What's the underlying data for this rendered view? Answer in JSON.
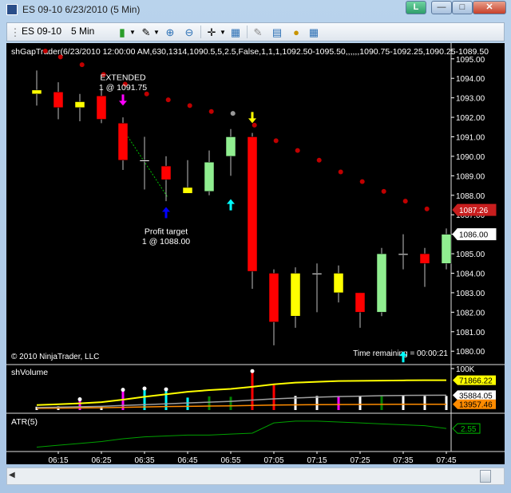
{
  "window": {
    "title": "ES 09-10  6/23/2010 (5 Min)",
    "button_l": "L"
  },
  "toolbar": {
    "instrument": "ES 09-10",
    "interval": "5 Min"
  },
  "chart_data": {
    "type": "candlestick",
    "indicator_label": "shGapTrader(6/23/2010 12:00:00 AM,630,1314,1090.5,5,2.5,False,1,1,1,1092.50-1095.50,,,,,,1090.75-1092.25,1090.25-1089.50",
    "copyright": "© 2010 NinjaTrader, LLC",
    "time_remaining": "Time remaining = 00:00:21",
    "price_ylim": [
      1079.6,
      1095.4
    ],
    "price_ticks": [
      1080,
      1081,
      1082,
      1083,
      1084,
      1085,
      1086,
      1087,
      1088,
      1089,
      1090,
      1091,
      1092,
      1093,
      1094,
      1095
    ],
    "price_tick_labels": [
      "1080.00",
      "1081.00",
      "1082.00",
      "1083.00",
      "1084.00",
      "1085.00",
      "1086.00",
      "1087.00",
      "1088.00",
      "1089.00",
      "1090.00",
      "1091.00",
      "1092.00",
      "1093.00",
      "1094.00",
      "1095.00"
    ],
    "price_badges": [
      {
        "value": 1087.25,
        "label": "1087.26",
        "color": "#c81e1e"
      },
      {
        "value": 1086.0,
        "label": "1086.00",
        "color": "#ffffff"
      }
    ],
    "x_labels": [
      "06:15",
      "06:25",
      "06:35",
      "06:45",
      "06:55",
      "07:05",
      "07:15",
      "07:25",
      "07:35",
      "07:45"
    ],
    "x_label_index": [
      1,
      3,
      5,
      7,
      9,
      11,
      13,
      15,
      17,
      19
    ],
    "candles": [
      {
        "o": 1093.4,
        "h": 1094.4,
        "l": 1092.6,
        "c": 1093.2,
        "color": "#ffff00"
      },
      {
        "o": 1093.3,
        "h": 1093.8,
        "l": 1091.9,
        "c": 1092.5,
        "color": "#ff0000"
      },
      {
        "o": 1092.5,
        "h": 1093.2,
        "l": 1091.8,
        "c": 1092.8,
        "color": "#ffff00"
      },
      {
        "o": 1093.1,
        "h": 1093.5,
        "l": 1091.7,
        "c": 1091.9,
        "color": "#ff0000"
      },
      {
        "o": 1091.7,
        "h": 1092.0,
        "l": 1089.3,
        "c": 1089.8,
        "color": "#ff0000"
      },
      {
        "o": 1089.8,
        "h": 1091.0,
        "l": 1088.3,
        "c": 1089.8,
        "color": "#ffffff"
      },
      {
        "o": 1089.5,
        "h": 1090.0,
        "l": 1087.7,
        "c": 1088.8,
        "color": "#ff0000"
      },
      {
        "o": 1088.4,
        "h": 1089.8,
        "l": 1088.1,
        "c": 1088.1,
        "color": "#ffff00"
      },
      {
        "o": 1088.2,
        "h": 1090.3,
        "l": 1088.0,
        "c": 1089.7,
        "color": "#90ee90"
      },
      {
        "o": 1090.0,
        "h": 1091.4,
        "l": 1089.0,
        "c": 1091.0,
        "color": "#90ee90"
      },
      {
        "o": 1091.0,
        "h": 1091.2,
        "l": 1083.2,
        "c": 1084.1,
        "color": "#ff0000"
      },
      {
        "o": 1084.0,
        "h": 1084.2,
        "l": 1080.3,
        "c": 1081.5,
        "color": "#ff0000"
      },
      {
        "o": 1081.8,
        "h": 1084.3,
        "l": 1081.2,
        "c": 1084.0,
        "color": "#ffff00"
      },
      {
        "o": 1084.0,
        "h": 1084.5,
        "l": 1082.0,
        "c": 1084.0,
        "color": "#ffffff"
      },
      {
        "o": 1084.0,
        "h": 1084.4,
        "l": 1082.5,
        "c": 1083.0,
        "color": "#ffff00"
      },
      {
        "o": 1083.0,
        "h": 1083.0,
        "l": 1081.2,
        "c": 1082.0,
        "color": "#ff0000"
      },
      {
        "o": 1082.0,
        "h": 1085.3,
        "l": 1081.8,
        "c": 1085.0,
        "color": "#90ee90"
      },
      {
        "o": 1085.0,
        "h": 1086.0,
        "l": 1084.2,
        "c": 1085.0,
        "color": "#ffffff"
      },
      {
        "o": 1085.0,
        "h": 1085.3,
        "l": 1083.3,
        "c": 1084.5,
        "color": "#ff0000"
      },
      {
        "o": 1084.5,
        "h": 1086.3,
        "l": 1084.2,
        "c": 1086.0,
        "color": "#90ee90"
      }
    ],
    "stop_dots": [
      {
        "i": 0.4,
        "v": 1095.4
      },
      {
        "i": 1.1,
        "v": 1095.1
      },
      {
        "i": 2.1,
        "v": 1094.7
      },
      {
        "i": 3.1,
        "v": 1094.2
      },
      {
        "i": 4.1,
        "v": 1093.7
      },
      {
        "i": 5.1,
        "v": 1093.2
      },
      {
        "i": 6.1,
        "v": 1092.9
      },
      {
        "i": 7.1,
        "v": 1092.6
      },
      {
        "i": 8.1,
        "v": 1092.3
      },
      {
        "i": 9.1,
        "v": 1092.2,
        "gray": true
      },
      {
        "i": 10.1,
        "v": 1091.6
      },
      {
        "i": 11.1,
        "v": 1090.8
      },
      {
        "i": 12.1,
        "v": 1090.3
      },
      {
        "i": 13.1,
        "v": 1089.8
      },
      {
        "i": 14.1,
        "v": 1089.2
      },
      {
        "i": 15.1,
        "v": 1088.7
      },
      {
        "i": 16.1,
        "v": 1088.2
      },
      {
        "i": 17.1,
        "v": 1087.7
      },
      {
        "i": 18.1,
        "v": 1087.3
      }
    ],
    "annotations": [
      {
        "text": "EXTENDED",
        "i": 4.0,
        "v": 1093.9
      },
      {
        "text": "1 @ 1091.75",
        "i": 4.0,
        "v": 1093.4
      },
      {
        "text": "Profit target",
        "i": 6.0,
        "v": 1086.0
      },
      {
        "text": "1 @ 1088.00",
        "i": 6.0,
        "v": 1085.5
      }
    ],
    "arrows": [
      {
        "i": 4,
        "v": 1092.6,
        "dir": "down",
        "color": "#ff00ff"
      },
      {
        "i": 6,
        "v": 1087.4,
        "dir": "up",
        "color": "#0000ff"
      },
      {
        "i": 9,
        "v": 1087.8,
        "dir": "up",
        "color": "#00ffff"
      },
      {
        "i": 10,
        "v": 1091.7,
        "dir": "down",
        "color": "#ffff00"
      },
      {
        "i": 17,
        "v": 1080.0,
        "dir": "up",
        "color": "#00ffff"
      }
    ],
    "volume": {
      "label": "shVolume",
      "ylim": [
        0,
        100000
      ],
      "ticks": [
        100000
      ],
      "tick_labels": [
        "100K"
      ],
      "badges": [
        {
          "value": 71866.22,
          "label": "71866.22",
          "color": "#ffff00"
        },
        {
          "value": 35884.05,
          "label": "35884.05",
          "color": "#ffffff"
        },
        {
          "value": 13957.46,
          "label": "13957.46",
          "color": "#ff8c00"
        }
      ],
      "bars": [
        {
          "v": 8000,
          "color": "#ffffff"
        },
        {
          "v": 9000,
          "color": "#ffffff"
        },
        {
          "v": 22000,
          "color": "#ff00ff"
        },
        {
          "v": 9000,
          "color": "#ffffff"
        },
        {
          "v": 45000,
          "color": "#ff00ff"
        },
        {
          "v": 48000,
          "color": "#00ffff"
        },
        {
          "v": 46000,
          "color": "#00ffff"
        },
        {
          "v": 30000,
          "color": "#00ffff"
        },
        {
          "v": 33000,
          "color": "#008000"
        },
        {
          "v": 32000,
          "color": "#008000"
        },
        {
          "v": 90000,
          "color": "#ff0000"
        },
        {
          "v": 60000,
          "color": "#ff0000"
        },
        {
          "v": 34000,
          "color": "#ffffff"
        },
        {
          "v": 34000,
          "color": "#ffffff"
        },
        {
          "v": 34000,
          "color": "#ff00ff"
        },
        {
          "v": 34000,
          "color": "#ffffff"
        },
        {
          "v": 34000,
          "color": "#008000"
        },
        {
          "v": 34000,
          "color": "#ffffff"
        },
        {
          "v": 34000,
          "color": "#ffffff"
        },
        {
          "v": 34000,
          "color": "#ffffff"
        }
      ],
      "dots": [
        2,
        4,
        5,
        6,
        10
      ],
      "avg_yellow": [
        12000,
        14000,
        16000,
        19000,
        25000,
        32000,
        38000,
        44000,
        48000,
        51000,
        56000,
        62000,
        66000,
        68000,
        70000,
        70500,
        71000,
        71500,
        71800,
        71866.22
      ],
      "avg_white": [
        6000,
        7000,
        8000,
        9000,
        11000,
        13000,
        15000,
        17000,
        19000,
        21000,
        24000,
        27000,
        29000,
        31000,
        32500,
        33500,
        34500,
        35200,
        35600,
        35884.05
      ],
      "avg_orange": [
        4000,
        4500,
        5000,
        5500,
        6500,
        7500,
        8500,
        9000,
        9500,
        10000,
        11000,
        12000,
        12500,
        13000,
        13300,
        13500,
        13700,
        13850,
        13900,
        13957.46
      ]
    },
    "atr": {
      "label": "ATR(5)",
      "ylim": [
        1.4,
        3.2
      ],
      "badges": [
        {
          "value": 2.55,
          "label": "2.55",
          "color": "#00c000"
        }
      ],
      "values": [
        1.55,
        1.65,
        1.75,
        1.85,
        2.0,
        2.1,
        2.15,
        2.2,
        2.2,
        2.25,
        2.3,
        2.85,
        2.95,
        2.95,
        2.9,
        2.85,
        2.8,
        2.75,
        2.7,
        2.55
      ]
    }
  }
}
